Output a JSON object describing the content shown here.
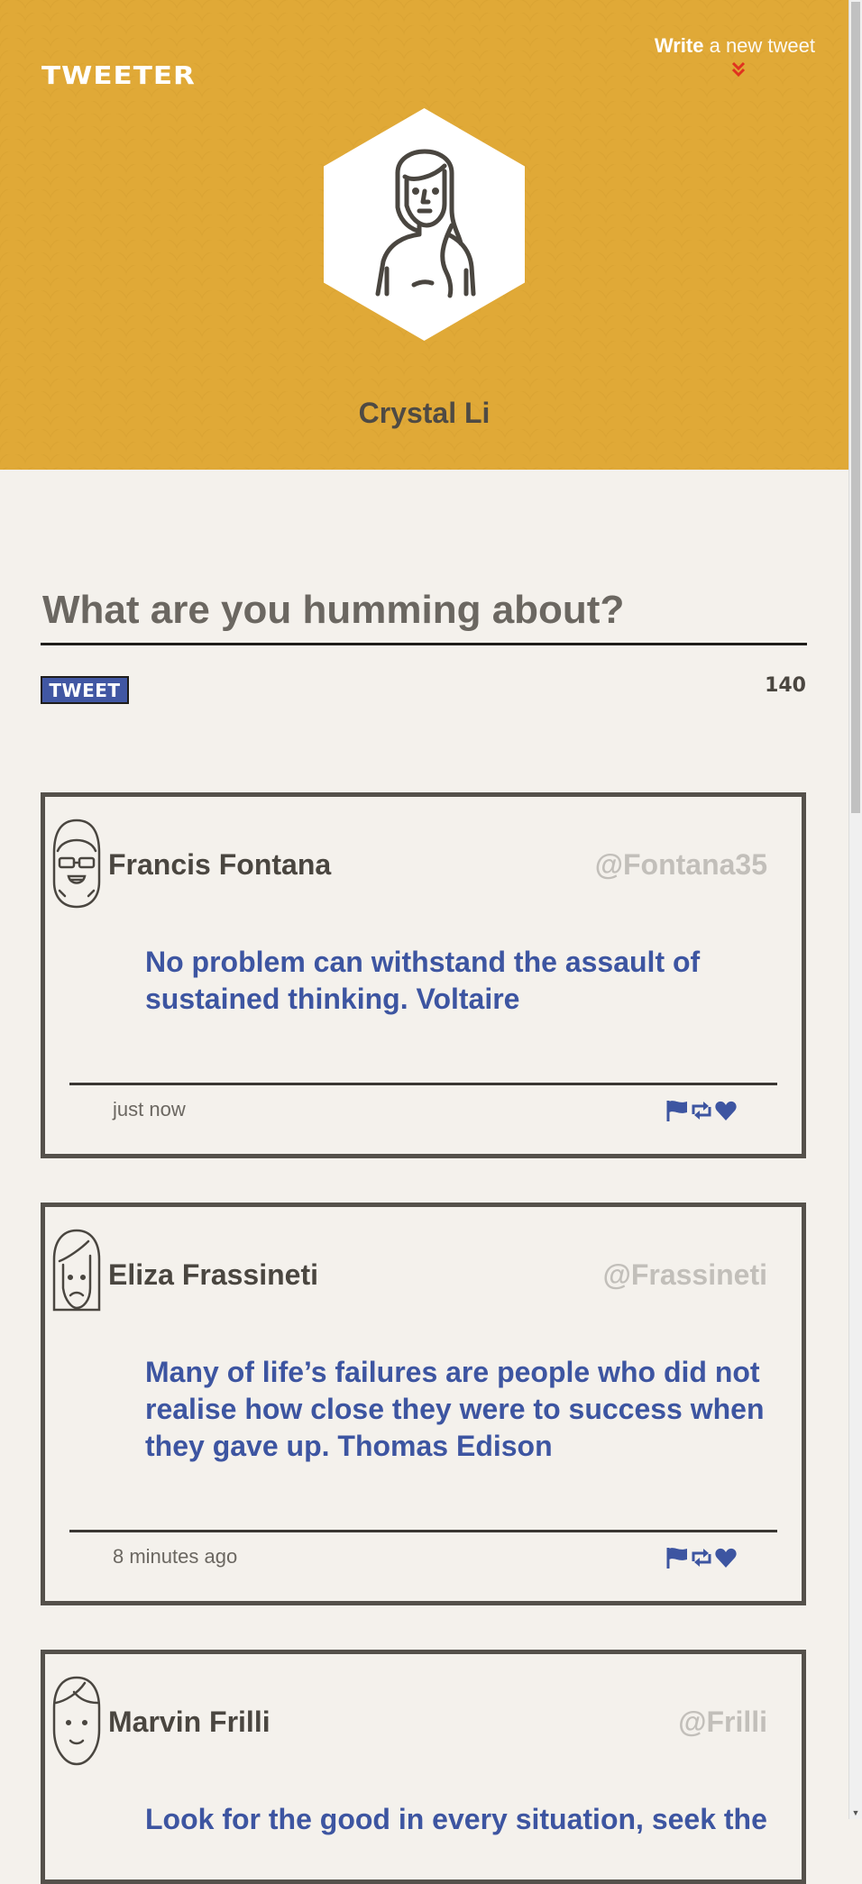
{
  "header": {
    "logo": "TWEETER",
    "compose_bold": "Write",
    "compose_rest": " a new tweet",
    "user_name": "Crystal Li",
    "accent_color": "#e0a937"
  },
  "composer": {
    "placeholder": "What are you humming about?",
    "button_label": "TWEET",
    "char_count": "140"
  },
  "tweets": [
    {
      "name": "Francis Fontana",
      "handle": "@Fontana35",
      "text": "No problem can withstand the assault of sustained thinking. Voltaire",
      "time": "just now",
      "avatar": "glasses-face-icon"
    },
    {
      "name": "Eliza Frassineti",
      "handle": "@Frassineti",
      "text": "Many of life’s failures are people who did not realise how close they were to success when they gave up. Thomas Edison",
      "time": "8 minutes ago",
      "avatar": "frowning-face-icon"
    },
    {
      "name": "Marvin Frilli",
      "handle": "@Frilli",
      "text": "Look for the good in every situation, seek the",
      "time": "",
      "avatar": "smiling-face-icon"
    }
  ],
  "colors": {
    "tweet_text": "#3d55a1",
    "handle": "#c2bfba",
    "page_bg": "#f4f1ec"
  }
}
